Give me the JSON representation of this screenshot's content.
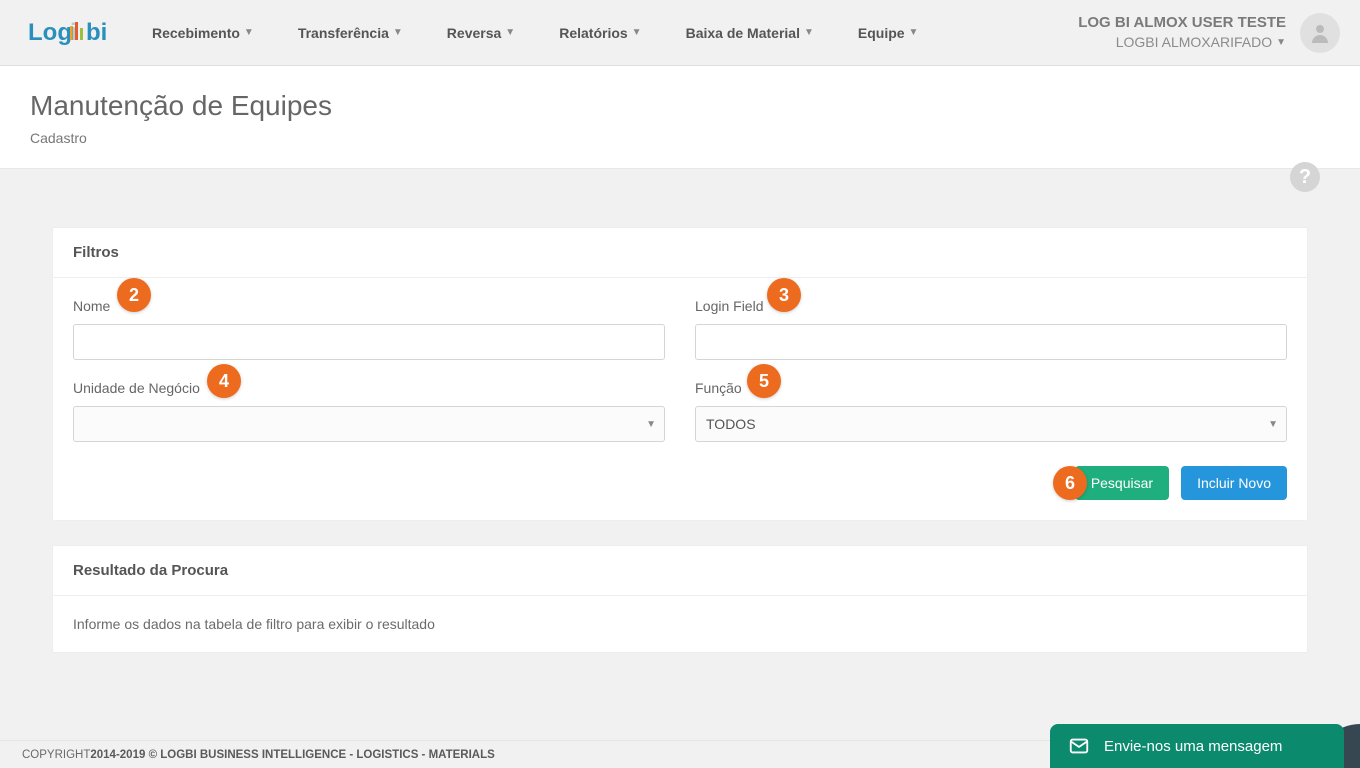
{
  "nav": {
    "items": [
      {
        "label": "Recebimento"
      },
      {
        "label": "Transferência"
      },
      {
        "label": "Reversa"
      },
      {
        "label": "Relatórios"
      },
      {
        "label": "Baixa de Material"
      },
      {
        "label": "Equipe"
      }
    ]
  },
  "user": {
    "name": "LOG BI ALMOX USER TESTE",
    "subunit": "LOGBI ALMOXARIFADO"
  },
  "page": {
    "title": "Manutenção de Equipes",
    "breadcrumb": "Cadastro"
  },
  "filters": {
    "heading": "Filtros",
    "nome": {
      "label": "Nome",
      "value": ""
    },
    "login": {
      "label": "Login Field",
      "value": ""
    },
    "unidade": {
      "label": "Unidade de Negócio",
      "value": ""
    },
    "funcao": {
      "label": "Função",
      "value": "TODOS"
    },
    "search_btn": "Pesquisar",
    "new_btn": "Incluir Novo"
  },
  "results": {
    "heading": "Resultado da Procura",
    "empty": "Informe os dados na tabela de filtro para exibir o resultado"
  },
  "footer": {
    "prefix": "COPYRIGHT",
    "text": "  2014-2019 © LOGBI BUSINESS INTELLIGENCE - LOGISTICS - MATERIALS"
  },
  "chat": {
    "text": "Envie-nos uma mensagem"
  },
  "badges": {
    "b2": "2",
    "b3": "3",
    "b4": "4",
    "b5": "5",
    "b6": "6"
  }
}
